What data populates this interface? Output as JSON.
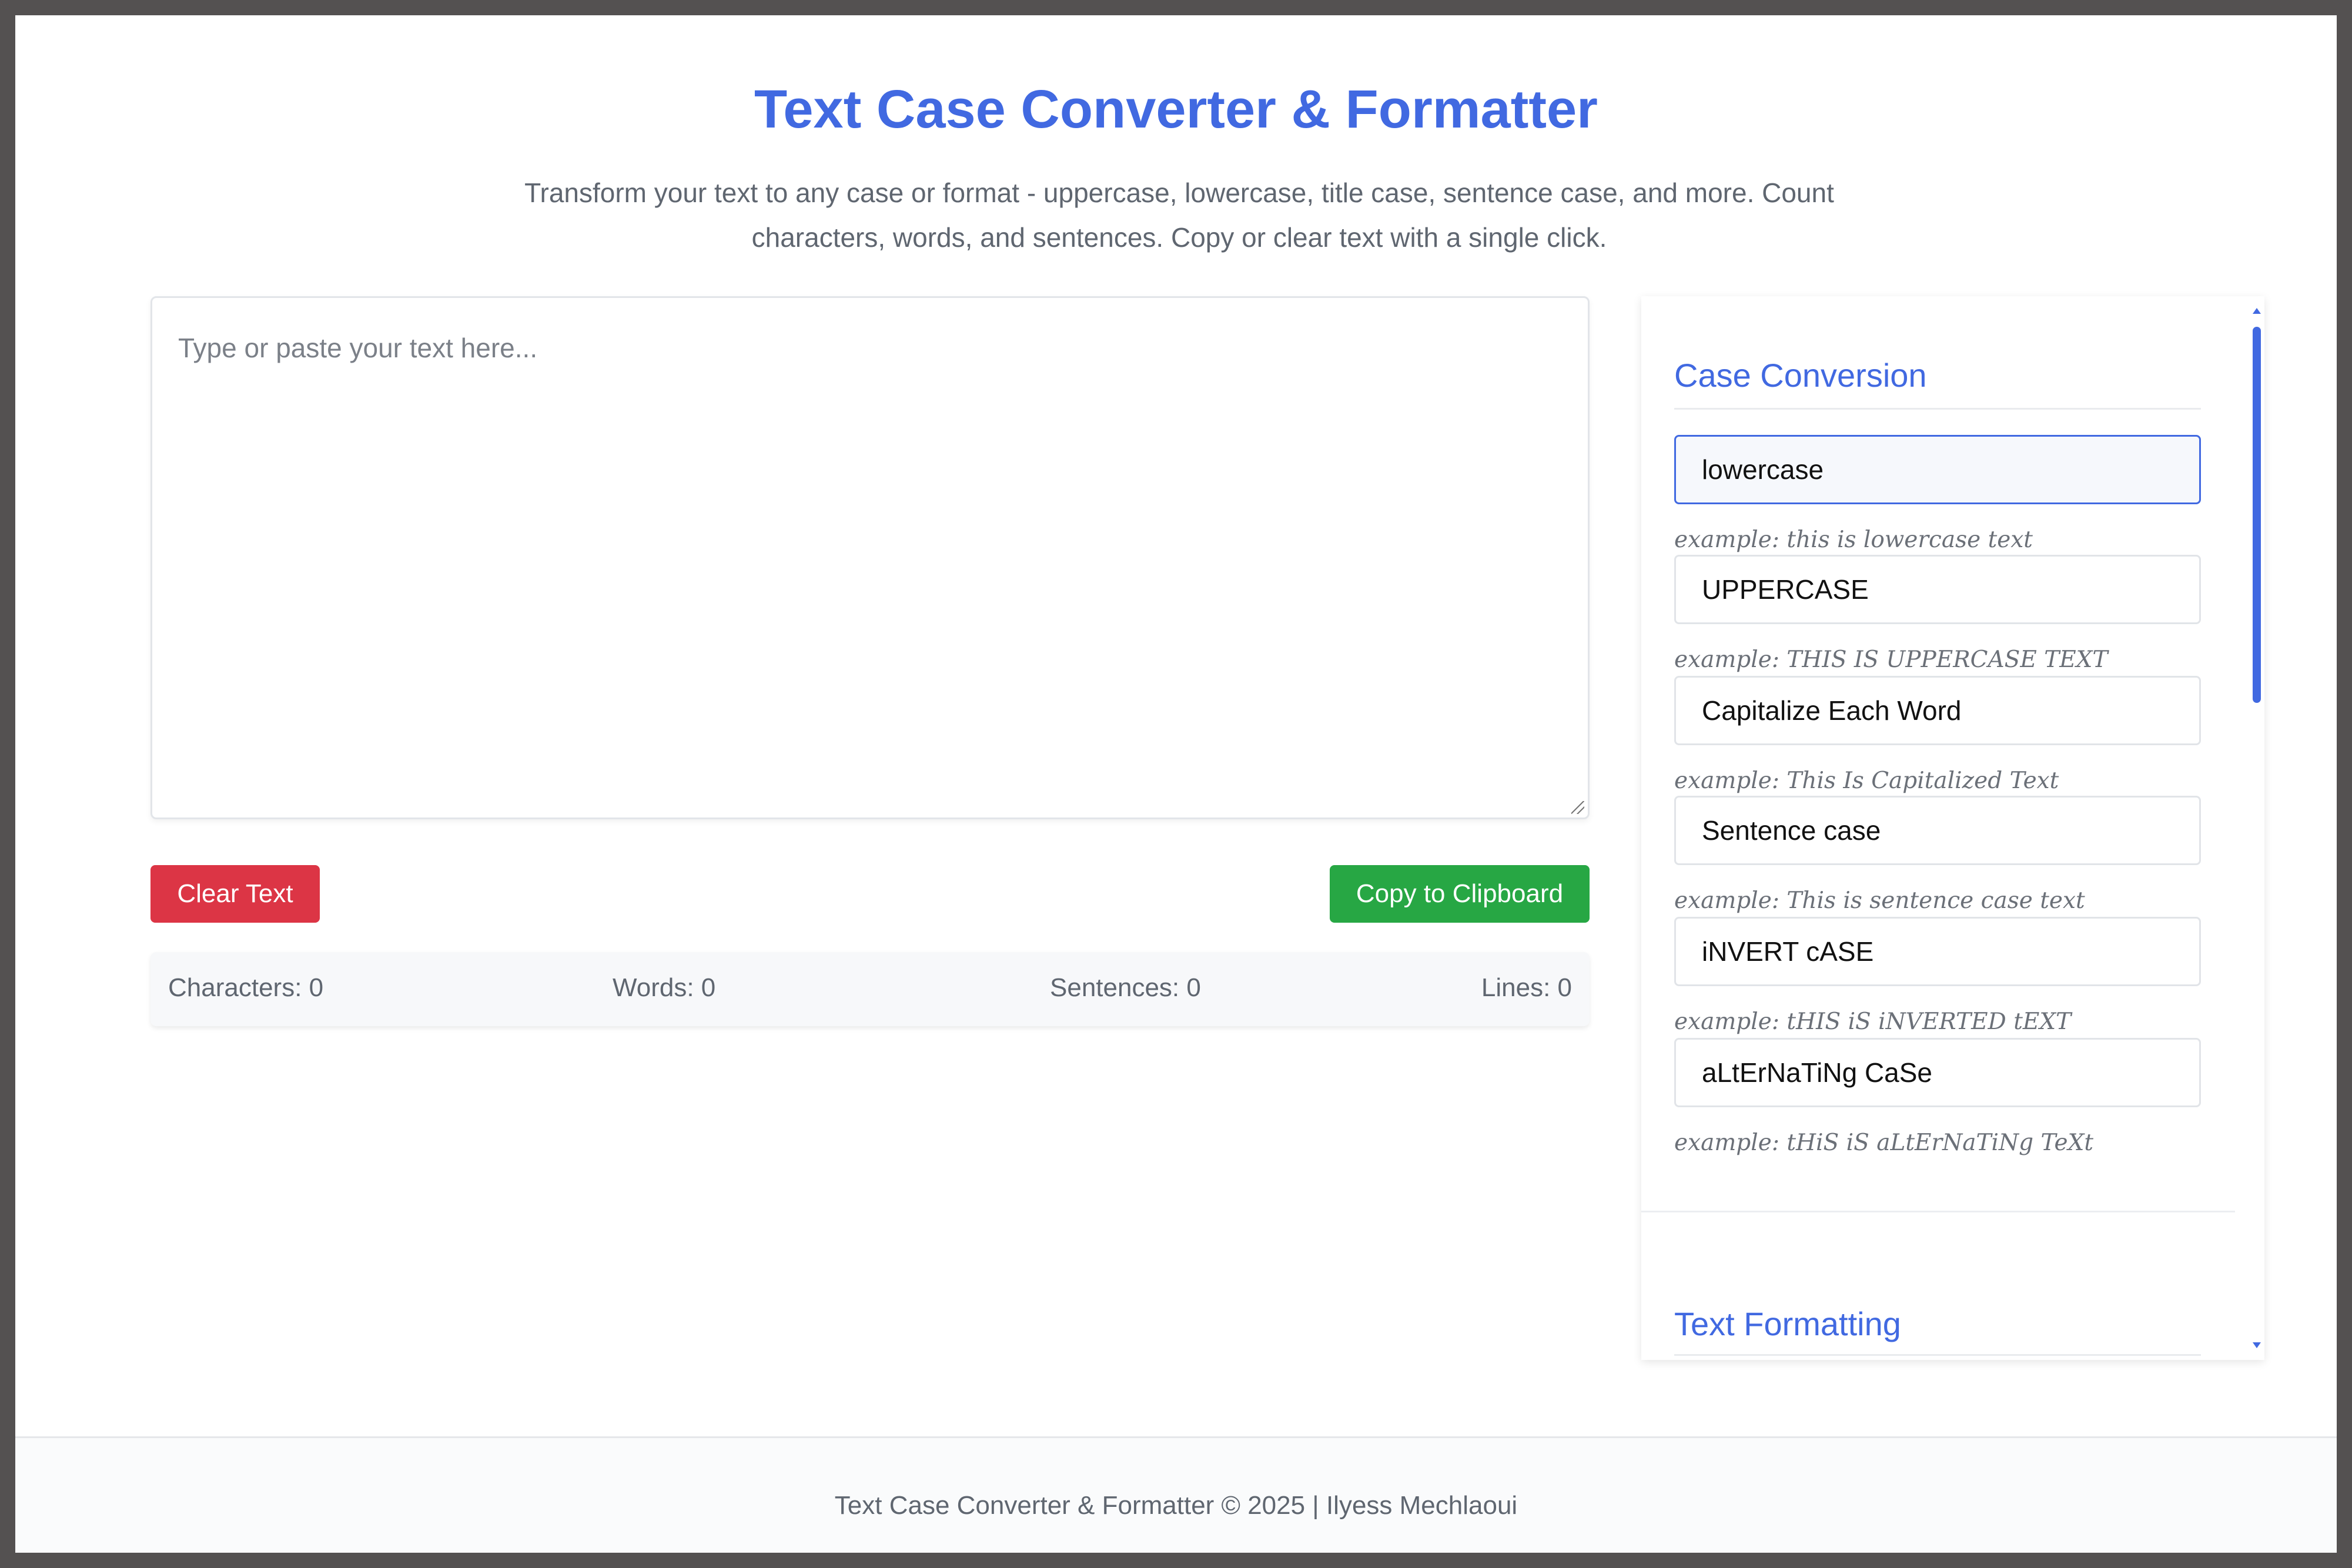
{
  "header": {
    "title": "Text Case Converter & Formatter",
    "subtitle": "Transform your text to any case or format - uppercase, lowercase, title case, sentence case, and more. Count characters, words, and sentences. Copy or clear text with a single click."
  },
  "editor": {
    "placeholder": "Type or paste your text here..."
  },
  "actions": {
    "clear_label": "Clear Text",
    "copy_label": "Copy to Clipboard"
  },
  "stats": {
    "characters": "Characters: 0",
    "words": "Words: 0",
    "sentences": "Sentences: 0",
    "lines": "Lines: 0"
  },
  "sidebar": {
    "case_conversion_title": "Case Conversion",
    "options": [
      {
        "label": "lowercase",
        "example": "example: this is lowercase text",
        "active": true
      },
      {
        "label": "UPPERCASE",
        "example": "example: THIS IS UPPERCASE TEXT",
        "active": false
      },
      {
        "label": "Capitalize Each Word",
        "example": "example: This Is Capitalized Text",
        "active": false
      },
      {
        "label": "Sentence case",
        "example": "example: This is sentence case text",
        "active": false
      },
      {
        "label": "iNVERT cASE",
        "example": "example: tHIS iS iNVERTED tEXT",
        "active": false
      },
      {
        "label": "aLtErNaTiNg CaSe",
        "example": "example: tHiS iS aLtErNaTiNg TeXt",
        "active": false
      }
    ],
    "text_formatting_title": "Text Formatting"
  },
  "footer": {
    "text": "Text Case Converter & Formatter © 2025 | Ilyess Mechlaoui"
  },
  "colors": {
    "accent": "#4169e1",
    "danger": "#dc3545",
    "success": "#27a744",
    "frame": "#545151"
  }
}
